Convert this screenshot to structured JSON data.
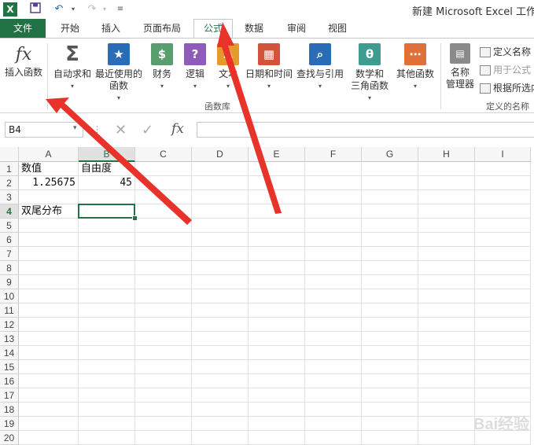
{
  "window": {
    "title": "新建 Microsoft Excel 工作表"
  },
  "quick_access": {
    "app_icon": "X",
    "icons": [
      "save-icon",
      "undo-icon",
      "redo-icon",
      "customize-icon"
    ]
  },
  "tabs": [
    {
      "label": "文件"
    },
    {
      "label": "开始"
    },
    {
      "label": "插入"
    },
    {
      "label": "页面布局"
    },
    {
      "label": "公式"
    },
    {
      "label": "数据"
    },
    {
      "label": "审阅"
    },
    {
      "label": "视图"
    }
  ],
  "ribbon": {
    "insert_function": {
      "label": "插入函数",
      "icon": "fx"
    },
    "buttons": [
      {
        "line1": "自动求和",
        "line2": "",
        "icon": "Σ",
        "color": "#6b6b6b"
      },
      {
        "line1": "最近使用的",
        "line2": "函数",
        "icon": "★",
        "color": "#2a6cb5"
      },
      {
        "line1": "财务",
        "line2": "",
        "icon": "$",
        "color": "#5a9e6f"
      },
      {
        "line1": "逻辑",
        "line2": "",
        "icon": "?",
        "color": "#8e5cb8"
      },
      {
        "line1": "文本",
        "line2": "",
        "icon": "A",
        "color": "#e39c2b"
      },
      {
        "line1": "日期和时间",
        "line2": "",
        "icon": "▦",
        "color": "#d2543a"
      },
      {
        "line1": "查找与引用",
        "line2": "",
        "icon": "⌕",
        "color": "#2a6cb5"
      },
      {
        "line1": "数学和",
        "line2": "三角函数",
        "icon": "θ",
        "color": "#3d9b8f"
      },
      {
        "line1": "其他函数",
        "line2": "",
        "icon": "⋯",
        "color": "#e0703a"
      }
    ],
    "group_label": "函数库",
    "name_manager": {
      "line1": "名称",
      "line2": "管理器"
    },
    "defined_names": {
      "items": [
        "定义名称",
        "用于公式",
        "根据所选内"
      ],
      "group_label": "定义的名称"
    }
  },
  "formula_bar": {
    "name_box": "B4",
    "fx": "fx",
    "value": ""
  },
  "sheet": {
    "columns": [
      "A",
      "B",
      "C",
      "D",
      "E",
      "F",
      "G",
      "H",
      "I"
    ],
    "rows": [
      "1",
      "2",
      "3",
      "4",
      "5",
      "6",
      "7",
      "8",
      "9",
      "10",
      "11",
      "12",
      "13",
      "14",
      "15",
      "16",
      "17",
      "18",
      "19",
      "20"
    ],
    "cells": {
      "A1": "数值",
      "B1": "自由度",
      "A2": "1.25675",
      "B2": "45",
      "A4": "双尾分布"
    },
    "active_cell": "B4"
  },
  "watermark": "Bai经验",
  "colors": {
    "accent": "#217346",
    "arrow": "#e8332b"
  }
}
